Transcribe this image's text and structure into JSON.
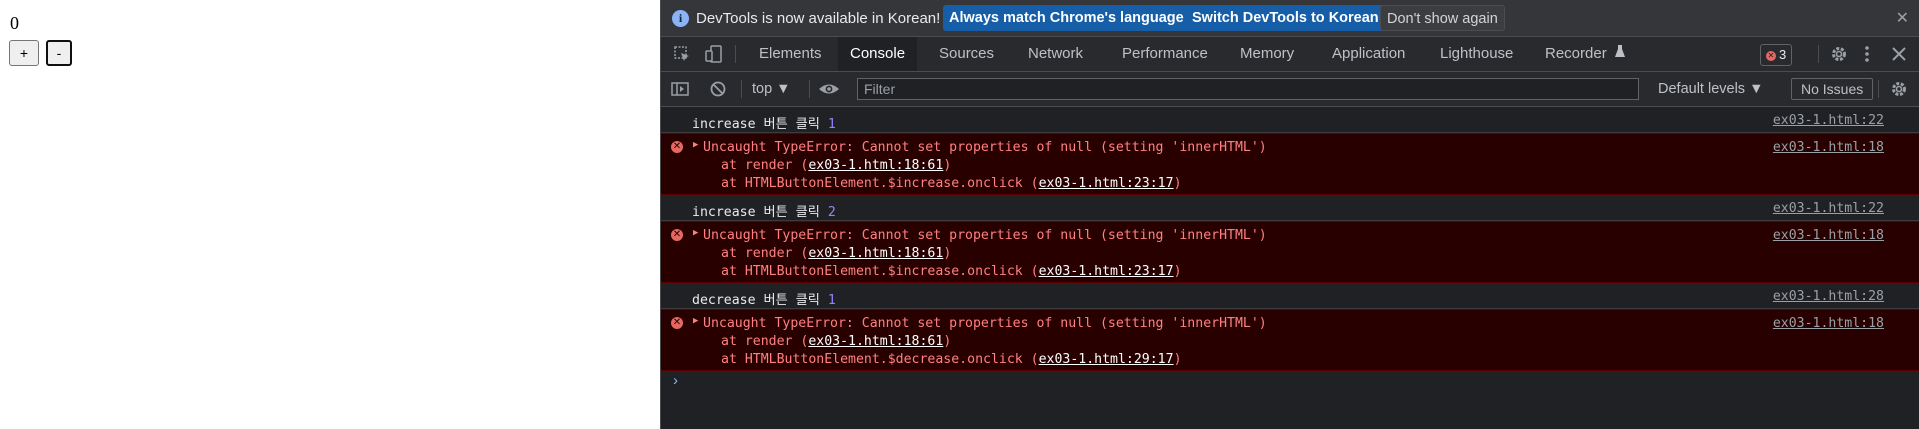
{
  "page": {
    "counter_value": "0",
    "plus_label": "+",
    "minus_label": "-"
  },
  "infobar": {
    "message": "DevTools is now available in Korean!",
    "btn_match": "Always match Chrome's language",
    "btn_switch": "Switch DevTools to Korean",
    "btn_dont": "Don't show again",
    "close": "✕"
  },
  "tabs": {
    "elements": "Elements",
    "console": "Console",
    "sources": "Sources",
    "network": "Network",
    "performance": "Performance",
    "memory": "Memory",
    "application": "Application",
    "lighthouse": "Lighthouse",
    "recorder": "Recorder",
    "error_count": "3"
  },
  "toolbar": {
    "context": "top ▼",
    "filter_placeholder": "Filter",
    "levels": "Default levels ▼",
    "issues": "No Issues"
  },
  "console": {
    "log1": {
      "text": "increase 버튼 클릭 ",
      "num": "1",
      "src": "ex03-1.html:22"
    },
    "err1": {
      "msg": "Uncaught TypeError: Cannot set properties of null (setting 'innerHTML')",
      "l2_pre": "at render (",
      "l2_link": "ex03-1.html:18:61",
      "l2_post": ")",
      "l3_pre": "at HTMLButtonElement.$increase.onclick (",
      "l3_link": "ex03-1.html:23:17",
      "l3_post": ")",
      "src": "ex03-1.html:18"
    },
    "log2": {
      "text": "increase 버튼 클릭 ",
      "num": "2",
      "src": "ex03-1.html:22"
    },
    "err2": {
      "msg": "Uncaught TypeError: Cannot set properties of null (setting 'innerHTML')",
      "l2_pre": "at render (",
      "l2_link": "ex03-1.html:18:61",
      "l2_post": ")",
      "l3_pre": "at HTMLButtonElement.$increase.onclick (",
      "l3_link": "ex03-1.html:23:17",
      "l3_post": ")",
      "src": "ex03-1.html:18"
    },
    "log3": {
      "text": "decrease 버튼 클릭 ",
      "num": "1",
      "src": "ex03-1.html:28"
    },
    "err3": {
      "msg": "Uncaught TypeError: Cannot set properties of null (setting 'innerHTML')",
      "l2_pre": "at render (",
      "l2_link": "ex03-1.html:18:61",
      "l2_post": ")",
      "l3_pre": "at HTMLButtonElement.$decrease.onclick (",
      "l3_link": "ex03-1.html:29:17",
      "l3_post": ")",
      "src": "ex03-1.html:18"
    },
    "prompt": "›"
  }
}
